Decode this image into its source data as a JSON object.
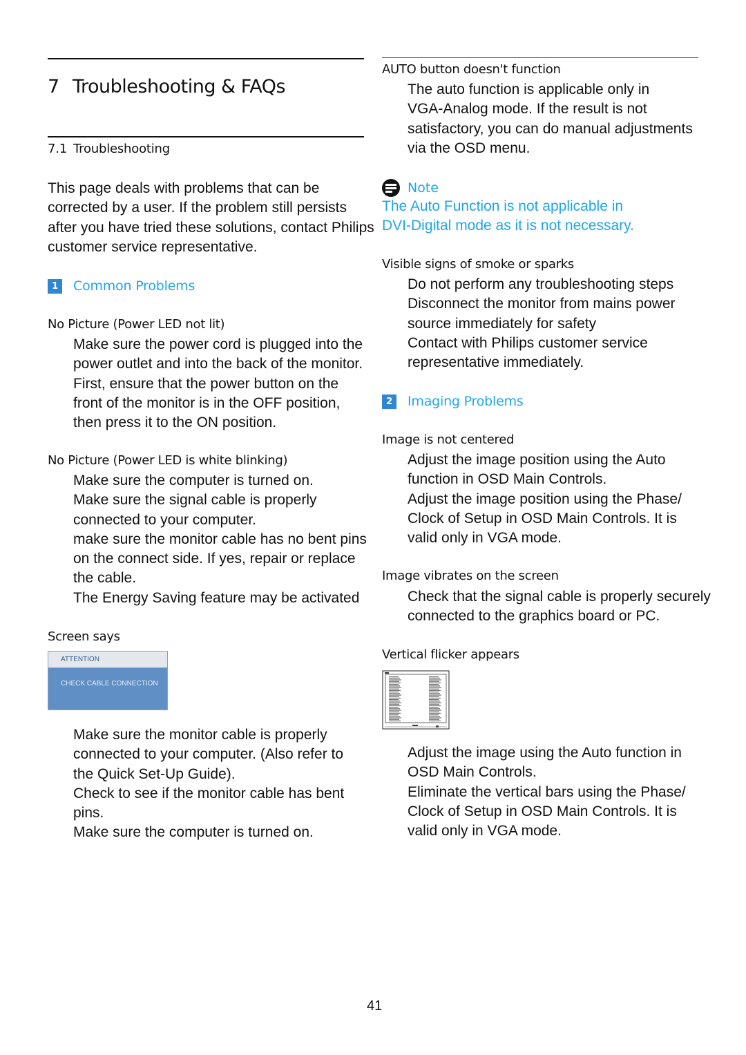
{
  "chapter": {
    "number": "7",
    "title": "Troubleshooting & FAQs"
  },
  "section": {
    "number": "7.1",
    "title": "Troubleshooting"
  },
  "intro": [
    "This page deals with problems that can be",
    "corrected by a user. If the problem still persists",
    "after you have tried these solutions, contact Philips",
    "customer service representative."
  ],
  "categories": [
    {
      "number": "1",
      "title": "Common Problems"
    },
    {
      "number": "2",
      "title": "Imaging Problems"
    }
  ],
  "left_column": {
    "problems": [
      {
        "heading": "No Picture (Power LED not lit)",
        "lines": [
          "Make sure the power cord is plugged into the",
          "power outlet and into the back of the monitor.",
          "First, ensure that the power button on the",
          "front of the monitor is in the OFF position,",
          "then press it to the ON position."
        ]
      },
      {
        "heading": "No Picture (Power LED is white blinking)",
        "lines": [
          "Make sure the computer is turned on.",
          "Make sure the signal cable is properly",
          "connected to your computer.",
          "make sure the monitor cable has no bent pins",
          "on the connect side. If yes, repair or replace",
          "the cable.",
          "The Energy Saving feature may be activated"
        ]
      },
      {
        "heading": "Screen says",
        "osd": {
          "header": "ATTENTION",
          "message": "CHECK CABLE CONNECTION"
        },
        "lines": [
          "Make sure the monitor cable is properly",
          "connected to your computer. (Also refer to",
          "the Quick Set-Up Guide).",
          "Check to see if the monitor cable has bent",
          "pins.",
          "Make sure the computer is turned on."
        ]
      }
    ]
  },
  "right_column": {
    "auto_button": {
      "heading": "AUTO button doesn't function",
      "lines": [
        "The auto function is applicable only in",
        "VGA-Analog mode.  If the result is not",
        "satisfactory, you can do manual adjustments",
        "via the OSD menu."
      ]
    },
    "note": {
      "label": "Note",
      "icon": "note-icon",
      "lines": [
        "The Auto Function is not applicable in",
        "DVI-Digital mode as it is not necessary."
      ]
    },
    "smoke": {
      "heading": "Visible signs of smoke or sparks",
      "lines": [
        "Do not perform any troubleshooting steps",
        "Disconnect the monitor from mains power",
        "source immediately for safety",
        "Contact with Philips customer service",
        "representative immediately."
      ]
    },
    "not_centered": {
      "heading": "Image is not centered",
      "lines": [
        "Adjust the image position using the Auto",
        "function in OSD Main Controls.",
        "Adjust the image position using the Phase/",
        "Clock of Setup in OSD Main Controls. It is",
        "valid only in VGA mode."
      ]
    },
    "vibrates": {
      "heading": "Image vibrates on the screen",
      "lines": [
        "Check that the signal cable is properly securely",
        "connected to the graphics board or PC."
      ]
    },
    "flicker": {
      "heading": "Vertical flicker appears",
      "image": "vertical-flicker-screen-illustration",
      "lines": [
        "Adjust the image using the  Auto  function in",
        "OSD Main Controls.",
        "Eliminate the vertical bars using the Phase/",
        "Clock of Setup in OSD Main Controls. It is",
        "valid only in VGA mode."
      ]
    }
  },
  "colors": {
    "accent": "#1ea6e8",
    "badge": "#2f86d1",
    "osd_body": "#5f8fc5"
  },
  "page_number": "41"
}
